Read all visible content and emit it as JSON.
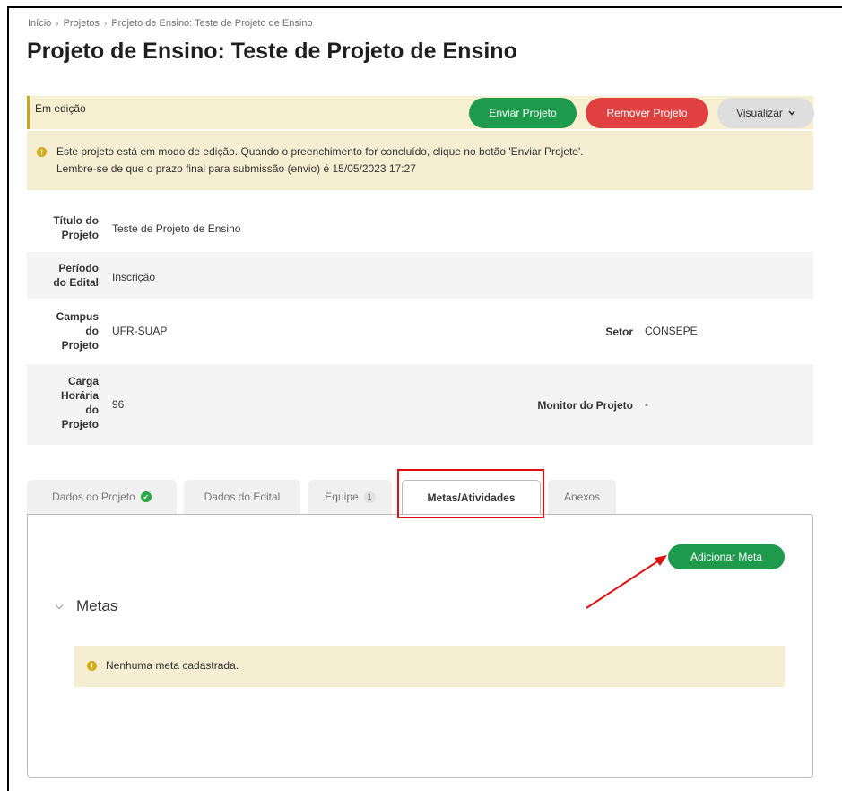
{
  "breadcrumb": {
    "items": [
      "Início",
      "Projetos",
      "Projeto de Ensino: Teste de Projeto de Ensino"
    ],
    "separator": "›"
  },
  "page_title": "Projeto de Ensino: Teste de Projeto de Ensino",
  "status": {
    "label": "Em edição",
    "buttons": {
      "send": "Enviar Projeto",
      "remove": "Remover Projeto",
      "view": "Visualizar"
    }
  },
  "alert": {
    "icon_glyph": "!",
    "line1": "Este projeto está em modo de edição. Quando o preenchimento for concluído, clique no botão 'Enviar Projeto'.",
    "line2": "Lembre-se de que o prazo final para submissão (envio) é 15/05/2023 17:27"
  },
  "info": {
    "titulo": {
      "label_lines": [
        "Título do",
        "Projeto"
      ],
      "value": "Teste de Projeto de Ensino"
    },
    "periodo": {
      "label_lines": [
        "Período",
        "do Edital"
      ],
      "value": "Inscrição"
    },
    "campus": {
      "label_lines": [
        "Campus",
        "do",
        "Projeto"
      ],
      "value": "UFR-SUAP"
    },
    "setor": {
      "label": "Setor",
      "value": "CONSEPE"
    },
    "carga": {
      "label_lines": [
        "Carga",
        "Horária",
        "do",
        "Projeto"
      ],
      "value": "96"
    },
    "monitor": {
      "label": "Monitor do Projeto",
      "value": "-"
    }
  },
  "tabs": [
    {
      "label": "Dados do Projeto",
      "check_glyph": "✔"
    },
    {
      "label": "Dados do Edital"
    },
    {
      "label": "Equipe",
      "badge": "1"
    },
    {
      "label": "Metas/Atividades",
      "active": true
    },
    {
      "label": "Anexos"
    }
  ],
  "panel": {
    "add_button": "Adicionar Meta",
    "section_title": "Metas",
    "empty_message": "Nenhuma meta cadastrada."
  },
  "colors": {
    "green": "#1e9a4d",
    "red": "#e04040",
    "warning_bg": "#f5eed2",
    "highlight": "#e01010"
  }
}
